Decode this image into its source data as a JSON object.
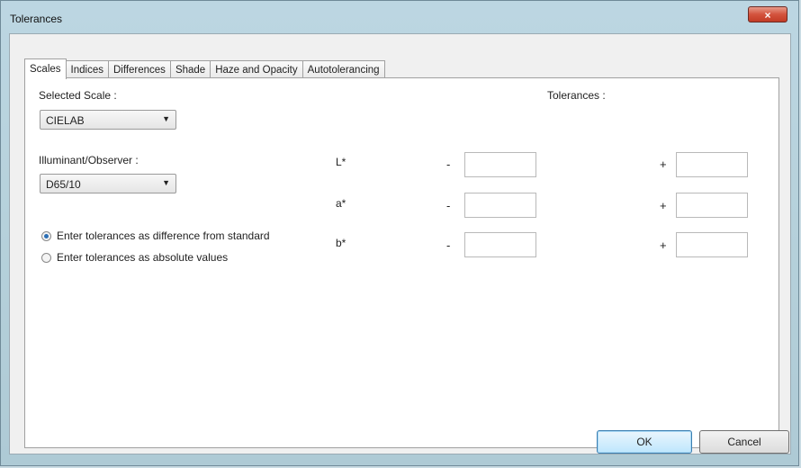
{
  "window": {
    "title": "Tolerances",
    "close_glyph": "×"
  },
  "tabs": [
    "Scales",
    "Indices",
    "Differences",
    "Shade",
    "Haze and Opacity",
    "Autotolerancing"
  ],
  "scales": {
    "selected_scale_label": "Selected Scale :",
    "selected_scale_value": "CIELAB",
    "illuminant_label": "Illuminant/Observer :",
    "illuminant_value": "D65/10",
    "tolerances_label": "Tolerances :",
    "radio_difference": "Enter tolerances as difference from standard",
    "radio_absolute": "Enter tolerances as absolute values",
    "rows": [
      {
        "label": "L*",
        "minus": "-",
        "plus": "+",
        "minus_value": "",
        "plus_value": ""
      },
      {
        "label": "a*",
        "minus": "-",
        "plus": "+",
        "minus_value": "",
        "plus_value": ""
      },
      {
        "label": "b*",
        "minus": "-",
        "plus": "+",
        "minus_value": "",
        "plus_value": ""
      }
    ]
  },
  "buttons": {
    "ok": "OK",
    "cancel": "Cancel"
  },
  "icons": {
    "dropdown": "chevron-down-icon"
  }
}
